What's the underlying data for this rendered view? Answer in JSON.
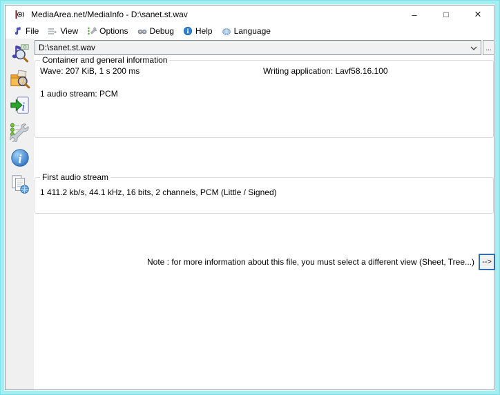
{
  "window": {
    "title": "MediaArea.net/MediaInfo - D:\\sanet.st.wav",
    "controls": {
      "minimize": "–",
      "maximize": "□",
      "close": "×"
    }
  },
  "menu": {
    "items": [
      {
        "label": "File",
        "icon": "file-note-icon"
      },
      {
        "label": "View",
        "icon": "view-list-icon"
      },
      {
        "label": "Options",
        "icon": "options-wrench-icon"
      },
      {
        "label": "Debug",
        "icon": "debug-binoculars-icon"
      },
      {
        "label": "Help",
        "icon": "help-info-icon"
      },
      {
        "label": "Language",
        "icon": "language-globe-icon"
      }
    ]
  },
  "file_selector": {
    "value": "D:\\sanet.st.wav",
    "browse_label": "..."
  },
  "sidebar": {
    "items": [
      {
        "name": "open-file"
      },
      {
        "name": "open-folder"
      },
      {
        "name": "export-info"
      },
      {
        "name": "preferences"
      },
      {
        "name": "about"
      },
      {
        "name": "mediainfo-web"
      }
    ]
  },
  "general_section": {
    "title": "Container and general information",
    "line1_left": "Wave: 207 KiB, 1 s 200 ms",
    "line1_right": "Writing application: Lavf58.16.100",
    "line2": "1 audio stream: PCM"
  },
  "audio_section": {
    "title": "First audio stream",
    "line1": "1 411.2 kb/s, 44.1 kHz, 16 bits, 2 channels, PCM (Little / Signed)"
  },
  "note": {
    "text": "Note : for more information about this file, you must select a different view (Sheet, Tree...)",
    "button_label": "-->"
  },
  "colors": {
    "frame": "#a4eef1",
    "titlebar": "#ffffff",
    "sidebar": "#f0f0f0",
    "group_border": "#d9d9d9",
    "note_button_border": "#2e6fad"
  }
}
